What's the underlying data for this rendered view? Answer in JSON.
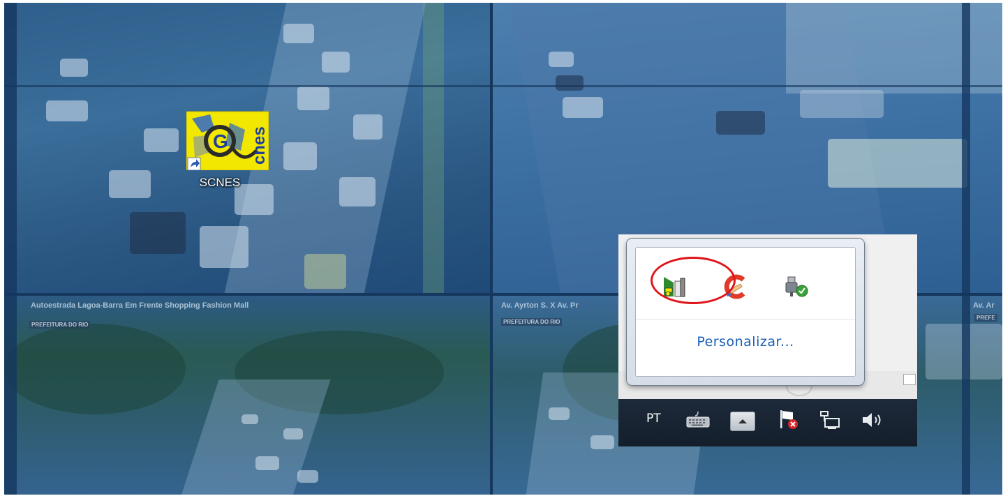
{
  "desktop": {
    "wallpaper": {
      "captions": [
        "Autoestrada Lagoa-Barra Em Frente Shopping Fashion Mall",
        "Av. Ayrton S. X Av. Pr"
      ],
      "tags": [
        "PREFEITURA DO RIO",
        "PREFEITURA DO RIO"
      ],
      "right_edge_caption": "Av. Ar",
      "right_edge_tag": "PREFE"
    },
    "shortcut": {
      "label": "SCNES",
      "icon_text": "cnes",
      "icon_letter": "G"
    }
  },
  "tray": {
    "overflow": {
      "icons": [
        {
          "name": "scnes-tray-icon"
        },
        {
          "name": "ccleaner-icon"
        },
        {
          "name": "safely-remove-hardware-icon"
        }
      ],
      "customize_label": "Personalizar..."
    },
    "taskbar": {
      "language": "PT",
      "icons": [
        "keyboard-icon",
        "show-hidden-icons-button",
        "action-center-flag-icon",
        "network-icon",
        "volume-icon"
      ]
    }
  },
  "colors": {
    "highlight_ring": "#e0141a",
    "link": "#1a5fb4",
    "taskbar": "#141e2b"
  }
}
